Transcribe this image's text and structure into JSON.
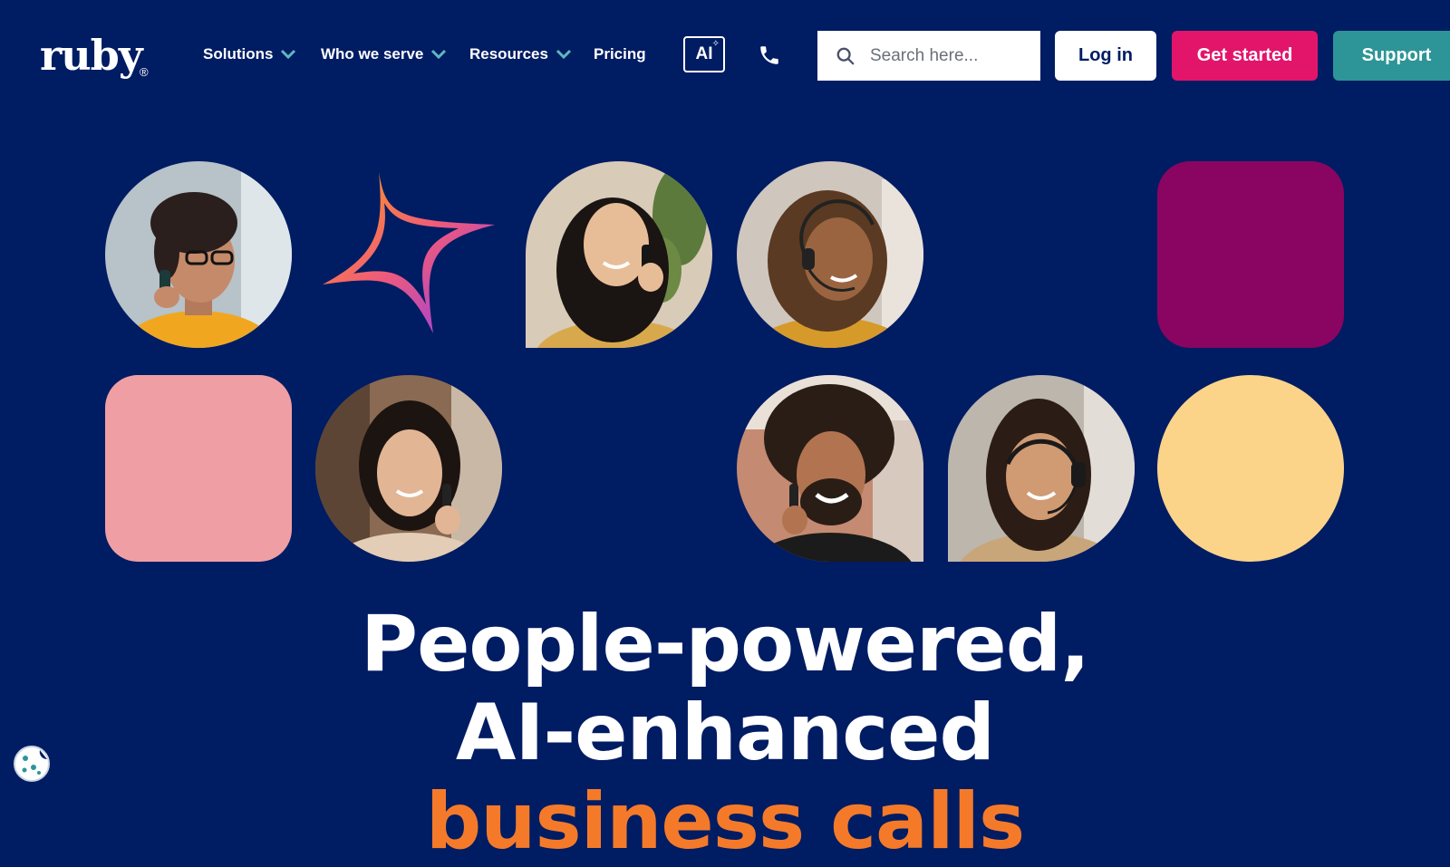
{
  "brand": {
    "name": "ruby",
    "registered": "®"
  },
  "nav": {
    "items": [
      {
        "label": "Solutions",
        "has_dropdown": true
      },
      {
        "label": "Who we serve",
        "has_dropdown": true
      },
      {
        "label": "Resources",
        "has_dropdown": true
      },
      {
        "label": "Pricing",
        "has_dropdown": false
      }
    ],
    "ai_label": "AI",
    "ai_icon": "sparkle-icon",
    "phone_icon": "phone-icon"
  },
  "search": {
    "placeholder": "Search here...",
    "value": "",
    "icon": "search-icon"
  },
  "buttons": {
    "login": "Log in",
    "get_started": "Get started",
    "support": "Support"
  },
  "colors": {
    "background": "#001c63",
    "accent_pink": "#e3156b",
    "accent_teal": "#2d9597",
    "tile_magenta": "#890561",
    "tile_pink": "#ef9fa4",
    "tile_yellow": "#fbd489",
    "headline_orange": "#f47a2a",
    "chevron": "#5fb8c0"
  },
  "hero": {
    "headline_line1": "People-powered,",
    "headline_line2": "AI-enhanced",
    "headline_line3": "business calls"
  },
  "cookie_icon": "cookie-icon"
}
